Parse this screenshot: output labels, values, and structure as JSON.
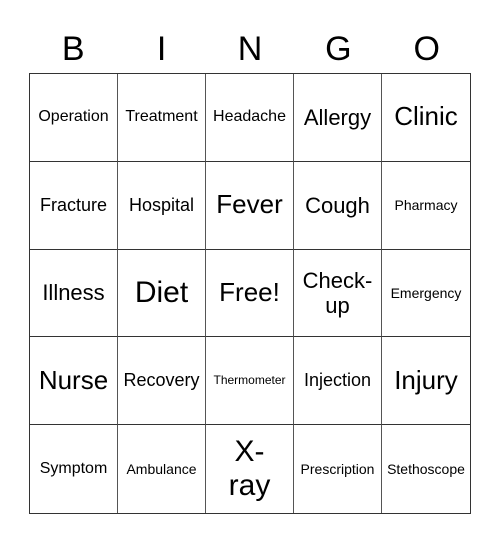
{
  "header": {
    "letters": [
      "B",
      "I",
      "N",
      "G",
      "O"
    ]
  },
  "board": {
    "rows": [
      [
        "Operation",
        "Treatment",
        "Headache",
        "Allergy",
        "Clinic"
      ],
      [
        "Fracture",
        "Hospital",
        "Fever",
        "Cough",
        "Pharmacy"
      ],
      [
        "Illness",
        "Diet",
        "Free!",
        "Check-up",
        "Emergency"
      ],
      [
        "Nurse",
        "Recovery",
        "Thermometer",
        "Injection",
        "Injury"
      ],
      [
        "Symptom",
        "Ambulance",
        "X-ray",
        "Prescription",
        "Stethoscope"
      ]
    ],
    "free_space": "Free!"
  },
  "colors": {
    "background": "#ffffff",
    "text": "#000000",
    "grid_line": "#333333"
  }
}
